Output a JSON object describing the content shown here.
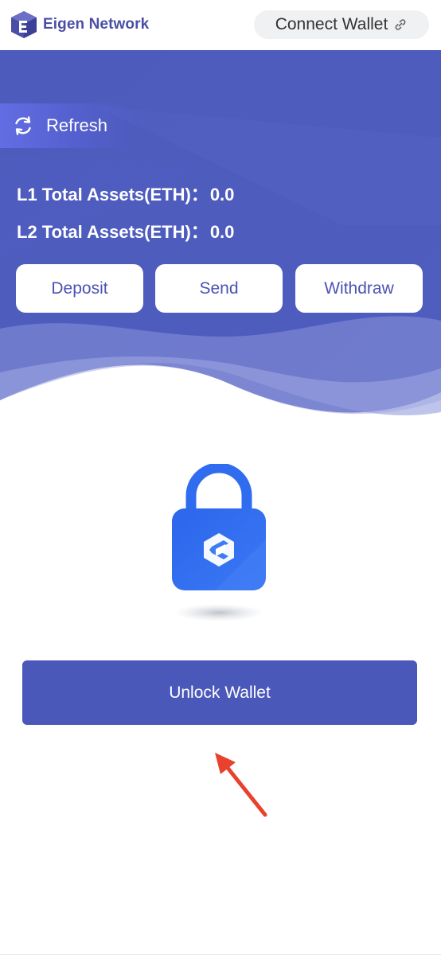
{
  "header": {
    "brand_name": "Eigen Network",
    "connect_label": "Connect Wallet",
    "logo_icon": "eigen-cube-logo",
    "link_icon": "link-icon"
  },
  "hero": {
    "refresh_label": "Refresh",
    "refresh_icon": "refresh-icon",
    "l1_label": "L1 Total Assets(ETH)：",
    "l1_value": "0.0",
    "l2_label": "L2 Total Assets(ETH)：",
    "l2_value": "0.0",
    "actions": [
      {
        "label": "Deposit"
      },
      {
        "label": "Send"
      },
      {
        "label": "Withdraw"
      }
    ]
  },
  "main": {
    "lock_icon": "lock-icon",
    "unlock_label": "Unlock Wallet",
    "annotation_arrow": "red-arrow-icon"
  },
  "colors": {
    "brand": "#4a4fa6",
    "hero_bg": "#4e5dbd",
    "button_text": "#4a52b5",
    "unlock_bg": "#4a58b9",
    "lock_blue": "#2f6cf0",
    "arrow_red": "#e8412d"
  }
}
